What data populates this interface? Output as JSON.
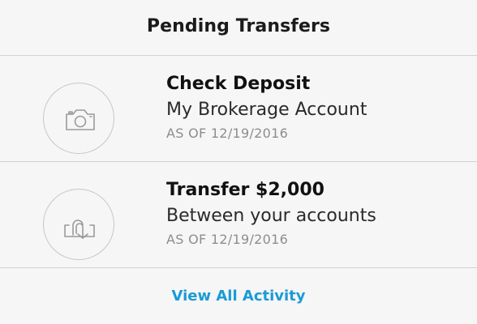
{
  "header": {
    "title": "Pending Transfers"
  },
  "transfers": [
    {
      "icon": "camera-icon",
      "title": "Check Deposit",
      "subtitle": "My Brokerage Account",
      "meta": "AS OF 12/19/2016"
    },
    {
      "icon": "transfer-arrows-icon",
      "title": "Transfer $2,000",
      "subtitle": "Between your accounts",
      "meta": "AS OF 12/19/2016"
    }
  ],
  "footer": {
    "view_all_label": "View All Activity"
  },
  "colors": {
    "background": "#f6f6f6",
    "divider": "#d2d2d2",
    "icon_stroke": "#9a9a9a",
    "link": "#1b9ad6",
    "meta_text": "#8d8d8d"
  }
}
